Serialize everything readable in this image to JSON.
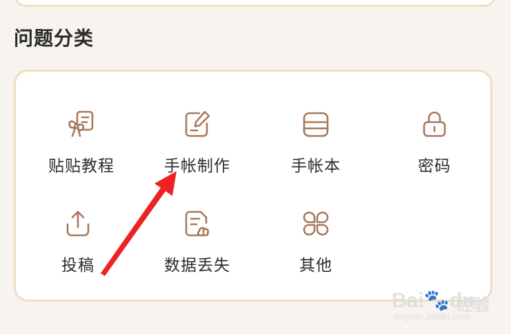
{
  "section": {
    "title": "问题分类"
  },
  "categories": [
    {
      "label": "贴贴教程",
      "icon": "ribbon-note-icon"
    },
    {
      "label": "手帐制作",
      "icon": "edit-note-icon"
    },
    {
      "label": "手帐本",
      "icon": "notebook-icon"
    },
    {
      "label": "密码",
      "icon": "lock-icon"
    },
    {
      "label": "投稿",
      "icon": "upload-icon"
    },
    {
      "label": "数据丢失",
      "icon": "data-loss-icon"
    },
    {
      "label": "其他",
      "icon": "more-grid-icon"
    }
  ],
  "colors": {
    "accent": "#a9775a",
    "card_border": "#f1dcc4",
    "background": "#f7f3ee",
    "arrow": "#ee2222"
  },
  "watermark": {
    "brand": "Bai",
    "brand_tail": "du",
    "text": "经验",
    "url": "jingyan.baidu.com"
  }
}
